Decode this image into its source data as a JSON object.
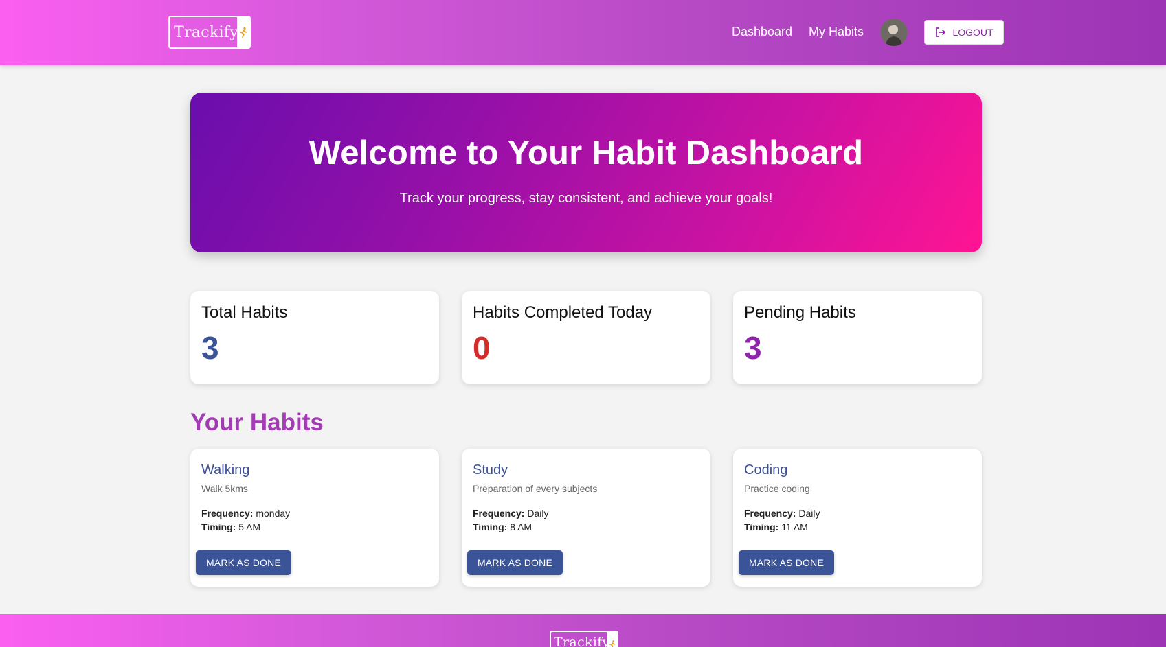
{
  "header": {
    "logo_text": "Trackify",
    "nav": {
      "dashboard": "Dashboard",
      "my_habits": "My Habits"
    },
    "logout_label": "LOGOUT"
  },
  "hero": {
    "title": "Welcome to Your Habit Dashboard",
    "subtitle": "Track your progress, stay consistent, and achieve your goals!"
  },
  "stats": [
    {
      "label": "Total Habits",
      "value": "3",
      "color": "#3b5497"
    },
    {
      "label": "Habits Completed Today",
      "value": "0",
      "color": "#d12d2d"
    },
    {
      "label": "Pending Habits",
      "value": "3",
      "color": "#8e24aa"
    }
  ],
  "habits_section": {
    "title": "Your Habits",
    "frequency_label": "Frequency:",
    "timing_label": "Timing:",
    "button_label": "MARK AS DONE",
    "items": [
      {
        "name": "Walking",
        "description": "Walk 5kms",
        "frequency": "monday",
        "timing": "5 AM"
      },
      {
        "name": "Study",
        "description": "Preparation of every subjects",
        "frequency": "Daily",
        "timing": "8 AM"
      },
      {
        "name": "Coding",
        "description": "Practice coding",
        "frequency": "Daily",
        "timing": "11 AM"
      }
    ]
  },
  "footer": {
    "logo_text": "Trackify"
  },
  "colors": {
    "accent": "#8e24aa",
    "button": "#3b5497",
    "section_title": "#a33cb4"
  }
}
